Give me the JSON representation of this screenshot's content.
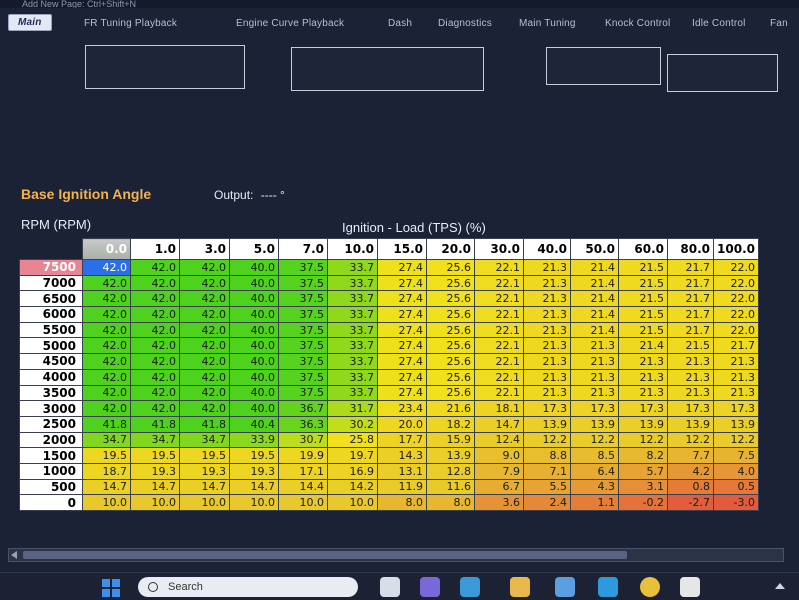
{
  "header": {
    "shortcut_text": "Add New Page: Ctrl+Shift+N"
  },
  "tabs": [
    {
      "label": "Main",
      "active": true
    },
    {
      "label": "FR Tuning Playback",
      "active": false
    },
    {
      "label": "Engine Curve Playback",
      "active": false
    },
    {
      "label": "Dash",
      "active": false
    },
    {
      "label": "Diagnostics",
      "active": false
    },
    {
      "label": "Main Tuning",
      "active": false
    },
    {
      "label": "Knock Control",
      "active": false
    },
    {
      "label": "Idle Control",
      "active": false
    },
    {
      "label": "Fan",
      "active": false
    }
  ],
  "map": {
    "title": "Base Ignition Angle",
    "output_label": "Output:",
    "output_value": "---- °",
    "rpm_axis_label": "RPM (RPM)",
    "load_axis_label": "Ignition - Load (TPS) (%)",
    "columns": [
      "0.0",
      "1.0",
      "3.0",
      "5.0",
      "7.0",
      "10.0",
      "15.0",
      "20.0",
      "30.0",
      "40.0",
      "50.0",
      "60.0",
      "80.0",
      "100.0"
    ],
    "rows": [
      {
        "rpm": "7500",
        "values": [
          "42.0",
          "42.0",
          "42.0",
          "40.0",
          "37.5",
          "33.7",
          "27.4",
          "25.6",
          "22.1",
          "21.3",
          "21.4",
          "21.5",
          "21.7",
          "22.0"
        ]
      },
      {
        "rpm": "7000",
        "values": [
          "42.0",
          "42.0",
          "42.0",
          "40.0",
          "37.5",
          "33.7",
          "27.4",
          "25.6",
          "22.1",
          "21.3",
          "21.4",
          "21.5",
          "21.7",
          "22.0"
        ]
      },
      {
        "rpm": "6500",
        "values": [
          "42.0",
          "42.0",
          "42.0",
          "40.0",
          "37.5",
          "33.7",
          "27.4",
          "25.6",
          "22.1",
          "21.3",
          "21.4",
          "21.5",
          "21.7",
          "22.0"
        ]
      },
      {
        "rpm": "6000",
        "values": [
          "42.0",
          "42.0",
          "42.0",
          "40.0",
          "37.5",
          "33.7",
          "27.4",
          "25.6",
          "22.1",
          "21.3",
          "21.4",
          "21.5",
          "21.7",
          "22.0"
        ]
      },
      {
        "rpm": "5500",
        "values": [
          "42.0",
          "42.0",
          "42.0",
          "40.0",
          "37.5",
          "33.7",
          "27.4",
          "25.6",
          "22.1",
          "21.3",
          "21.4",
          "21.5",
          "21.7",
          "22.0"
        ]
      },
      {
        "rpm": "5000",
        "values": [
          "42.0",
          "42.0",
          "42.0",
          "40.0",
          "37.5",
          "33.7",
          "27.4",
          "25.6",
          "22.1",
          "21.3",
          "21.3",
          "21.4",
          "21.5",
          "21.7"
        ]
      },
      {
        "rpm": "4500",
        "values": [
          "42.0",
          "42.0",
          "42.0",
          "40.0",
          "37.5",
          "33.7",
          "27.4",
          "25.6",
          "22.1",
          "21.3",
          "21.3",
          "21.3",
          "21.3",
          "21.3"
        ]
      },
      {
        "rpm": "4000",
        "values": [
          "42.0",
          "42.0",
          "42.0",
          "40.0",
          "37.5",
          "33.7",
          "27.4",
          "25.6",
          "22.1",
          "21.3",
          "21.3",
          "21.3",
          "21.3",
          "21.3"
        ]
      },
      {
        "rpm": "3500",
        "values": [
          "42.0",
          "42.0",
          "42.0",
          "40.0",
          "37.5",
          "33.7",
          "27.4",
          "25.6",
          "22.1",
          "21.3",
          "21.3",
          "21.3",
          "21.3",
          "21.3"
        ]
      },
      {
        "rpm": "3000",
        "values": [
          "42.0",
          "42.0",
          "42.0",
          "40.0",
          "36.7",
          "31.7",
          "23.4",
          "21.6",
          "18.1",
          "17.3",
          "17.3",
          "17.3",
          "17.3",
          "17.3"
        ]
      },
      {
        "rpm": "2500",
        "values": [
          "41.8",
          "41.8",
          "41.8",
          "40.4",
          "36.3",
          "30.2",
          "20.0",
          "18.2",
          "14.7",
          "13.9",
          "13.9",
          "13.9",
          "13.9",
          "13.9"
        ]
      },
      {
        "rpm": "2000",
        "values": [
          "34.7",
          "34.7",
          "34.7",
          "33.9",
          "30.7",
          "25.8",
          "17.7",
          "15.9",
          "12.4",
          "12.2",
          "12.2",
          "12.2",
          "12.2",
          "12.2"
        ]
      },
      {
        "rpm": "1500",
        "values": [
          "19.5",
          "19.5",
          "19.5",
          "19.5",
          "19.9",
          "19.7",
          "14.3",
          "13.9",
          "9.0",
          "8.8",
          "8.5",
          "8.2",
          "7.7",
          "7.5"
        ]
      },
      {
        "rpm": "1000",
        "values": [
          "18.7",
          "19.3",
          "19.3",
          "19.3",
          "17.1",
          "16.9",
          "13.1",
          "12.8",
          "7.9",
          "7.1",
          "6.4",
          "5.7",
          "4.2",
          "4.0"
        ]
      },
      {
        "rpm": "500",
        "values": [
          "14.7",
          "14.7",
          "14.7",
          "14.7",
          "14.4",
          "14.2",
          "11.9",
          "11.6",
          "6.7",
          "5.5",
          "4.3",
          "3.1",
          "0.8",
          "0.5"
        ]
      },
      {
        "rpm": "0",
        "values": [
          "10.0",
          "10.0",
          "10.0",
          "10.0",
          "10.0",
          "10.0",
          "8.0",
          "8.0",
          "3.6",
          "2.4",
          "1.1",
          "-0.2",
          "-2.7",
          "-3.0"
        ]
      }
    ],
    "selected_cell": {
      "row": 0,
      "col": 0
    }
  },
  "taskbar": {
    "search_placeholder": "Search"
  },
  "colors": {
    "heat_high": "#4fd21e",
    "heat_mid": "#f2e21a",
    "heat_low": "#e35a3c",
    "title": "#f2b24c",
    "background": "#1b2236"
  }
}
